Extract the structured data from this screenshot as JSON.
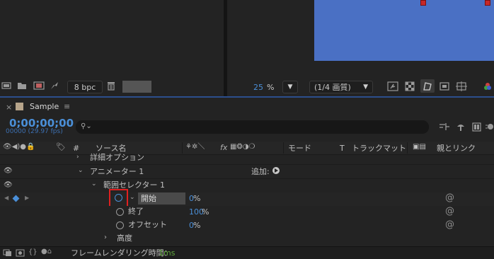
{
  "project": {
    "bpc_label": "8 bpc"
  },
  "viewer": {
    "zoom_value": "25",
    "zoom_unit": "%",
    "resolution": "(1/4 画質)"
  },
  "timeline": {
    "comp_name": "Sample",
    "timecode": "0;00;00;00",
    "frame_info": "00000 (29.97 fps)",
    "search_placeholder": "",
    "headers": {
      "hash": "#",
      "source_name": "ソース名",
      "fx": "fx",
      "mode": "モード",
      "t": "T",
      "track_matte": "トラックマット",
      "parent": "親とリンク"
    },
    "rows": {
      "advanced_options": "詳細オプション",
      "animator": "アニメーター 1",
      "add_label": "追加:",
      "range_selector": "範囲セレクター 1",
      "start_label": "開始",
      "start_value": "0",
      "start_unit": "%",
      "end_label": "終了",
      "end_value": "100",
      "end_unit": "%",
      "offset_label": "オフセット",
      "offset_value": "0",
      "offset_unit": "%",
      "height_label": "高度"
    },
    "status": {
      "render_label": "フレームレンダリング時間：",
      "render_value": "1ms"
    }
  },
  "colors": {
    "accent_blue": "#4a8fd8",
    "comp_bg": "#4a70c4",
    "highlight_red": "#e02020"
  }
}
